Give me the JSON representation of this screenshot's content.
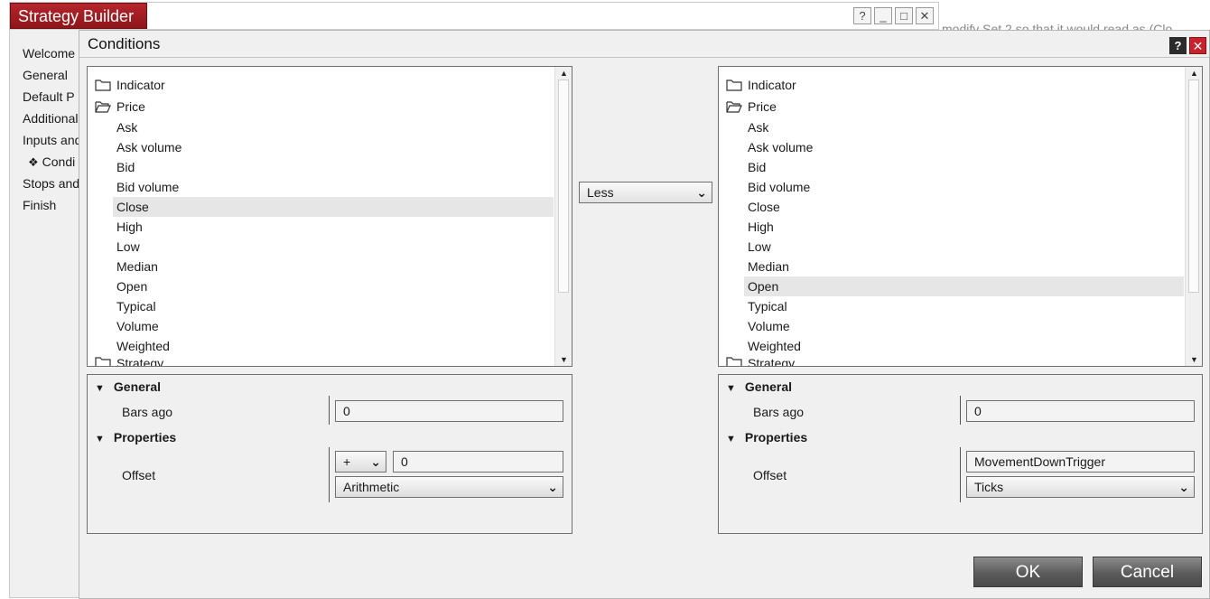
{
  "bg_window": {
    "title": "Strategy Builder",
    "controls": [
      "?",
      "_",
      "□",
      "✕"
    ],
    "nav": [
      "Welcome",
      "General",
      "Default P",
      "Additional",
      "Inputs and",
      "Condi",
      "Stops and",
      "Finish"
    ],
    "active_bullet": "❖",
    "hint_text": "modify Set 2 so that it would read as (Clo"
  },
  "dialog": {
    "title": "Conditions",
    "help": "?",
    "close": "✕",
    "operator": "Less",
    "ok_label": "OK",
    "cancel_label": "Cancel"
  },
  "left": {
    "tree": {
      "folder_indicator": "Indicator",
      "folder_price": "Price",
      "items": [
        "Ask",
        "Ask volume",
        "Bid",
        "Bid volume",
        "Close",
        "High",
        "Low",
        "Median",
        "Open",
        "Typical",
        "Volume",
        "Weighted"
      ],
      "selected": "Close",
      "folder_partial": "Strategy"
    },
    "props": {
      "general": "General",
      "bars_ago_label": "Bars ago",
      "bars_ago_value": "0",
      "properties": "Properties",
      "offset_label": "Offset",
      "offset_sign": "+",
      "offset_value": "0",
      "offset_type": "Arithmetic"
    }
  },
  "right": {
    "tree": {
      "folder_indicator": "Indicator",
      "folder_price": "Price",
      "items": [
        "Ask",
        "Ask volume",
        "Bid",
        "Bid volume",
        "Close",
        "High",
        "Low",
        "Median",
        "Open",
        "Typical",
        "Volume",
        "Weighted"
      ],
      "selected": "Open",
      "folder_partial": "Strategy"
    },
    "props": {
      "general": "General",
      "bars_ago_label": "Bars ago",
      "bars_ago_value": "0",
      "properties": "Properties",
      "offset_label": "Offset",
      "offset_value": "MovementDownTrigger",
      "offset_type": "Ticks"
    }
  },
  "icons": {
    "folder": "folder-icon",
    "folder_open": "folder-open-icon",
    "chevron": "chevron-down-icon",
    "triangle": "expand-triangle-icon"
  }
}
